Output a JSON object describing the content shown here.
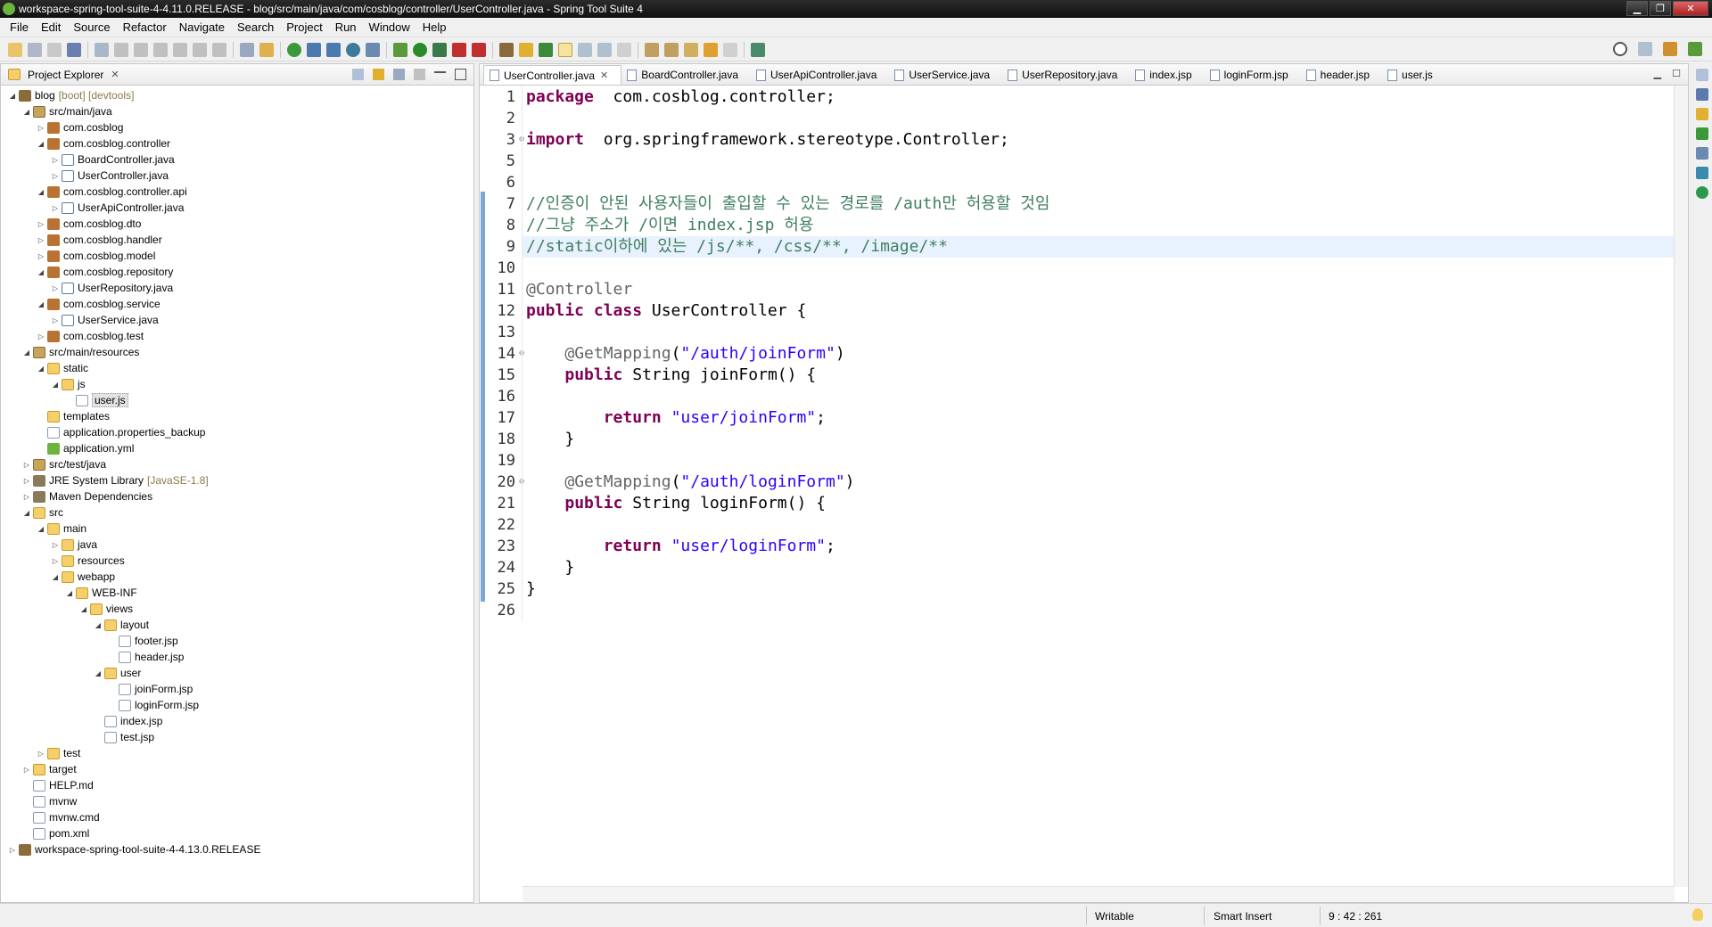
{
  "window": {
    "title": "workspace-spring-tool-suite-4-4.11.0.RELEASE - blog/src/main/java/com/cosblog/controller/UserController.java - Spring Tool Suite 4"
  },
  "menu": [
    "File",
    "Edit",
    "Source",
    "Refactor",
    "Navigate",
    "Search",
    "Project",
    "Run",
    "Window",
    "Help"
  ],
  "project_explorer": {
    "title": "Project Explorer",
    "tree": [
      {
        "label": "blog",
        "deco": "[boot] [devtools]",
        "depth": 0,
        "twisty": "open",
        "icon": "project"
      },
      {
        "label": "src/main/java",
        "depth": 1,
        "twisty": "open",
        "icon": "srcfolder"
      },
      {
        "label": "com.cosblog",
        "depth": 2,
        "twisty": "closed",
        "icon": "package"
      },
      {
        "label": "com.cosblog.controller",
        "depth": 2,
        "twisty": "open",
        "icon": "package"
      },
      {
        "label": "BoardController.java",
        "depth": 3,
        "twisty": "closed",
        "icon": "java"
      },
      {
        "label": "UserController.java",
        "depth": 3,
        "twisty": "closed",
        "icon": "java"
      },
      {
        "label": "com.cosblog.controller.api",
        "depth": 2,
        "twisty": "open",
        "icon": "package"
      },
      {
        "label": "UserApiController.java",
        "depth": 3,
        "twisty": "closed",
        "icon": "java"
      },
      {
        "label": "com.cosblog.dto",
        "depth": 2,
        "twisty": "closed",
        "icon": "package"
      },
      {
        "label": "com.cosblog.handler",
        "depth": 2,
        "twisty": "closed",
        "icon": "package"
      },
      {
        "label": "com.cosblog.model",
        "depth": 2,
        "twisty": "closed",
        "icon": "package"
      },
      {
        "label": "com.cosblog.repository",
        "depth": 2,
        "twisty": "open",
        "icon": "package"
      },
      {
        "label": "UserRepository.java",
        "depth": 3,
        "twisty": "closed",
        "icon": "java"
      },
      {
        "label": "com.cosblog.service",
        "depth": 2,
        "twisty": "open",
        "icon": "package"
      },
      {
        "label": "UserService.java",
        "depth": 3,
        "twisty": "closed",
        "icon": "java"
      },
      {
        "label": "com.cosblog.test",
        "depth": 2,
        "twisty": "closed",
        "icon": "package"
      },
      {
        "label": "src/main/resources",
        "depth": 1,
        "twisty": "open",
        "icon": "srcfolder"
      },
      {
        "label": "static",
        "depth": 2,
        "twisty": "open",
        "icon": "folder"
      },
      {
        "label": "js",
        "depth": 3,
        "twisty": "open",
        "icon": "folder"
      },
      {
        "label": "user.js",
        "depth": 4,
        "twisty": "none",
        "icon": "file",
        "selected": true
      },
      {
        "label": "templates",
        "depth": 2,
        "twisty": "none",
        "icon": "folder"
      },
      {
        "label": "application.properties_backup",
        "depth": 2,
        "twisty": "none",
        "icon": "file"
      },
      {
        "label": "application.yml",
        "depth": 2,
        "twisty": "none",
        "icon": "yml"
      },
      {
        "label": "src/test/java",
        "depth": 1,
        "twisty": "closed",
        "icon": "srcfolder"
      },
      {
        "label": "JRE System Library",
        "deco": "[JavaSE-1.8]",
        "depth": 1,
        "twisty": "closed",
        "icon": "lib"
      },
      {
        "label": "Maven Dependencies",
        "depth": 1,
        "twisty": "closed",
        "icon": "lib"
      },
      {
        "label": "src",
        "depth": 1,
        "twisty": "open",
        "icon": "folder"
      },
      {
        "label": "main",
        "depth": 2,
        "twisty": "open",
        "icon": "folder"
      },
      {
        "label": "java",
        "depth": 3,
        "twisty": "closed",
        "icon": "folder"
      },
      {
        "label": "resources",
        "depth": 3,
        "twisty": "closed",
        "icon": "folder"
      },
      {
        "label": "webapp",
        "depth": 3,
        "twisty": "open",
        "icon": "folder"
      },
      {
        "label": "WEB-INF",
        "depth": 4,
        "twisty": "open",
        "icon": "folder"
      },
      {
        "label": "views",
        "depth": 5,
        "twisty": "open",
        "icon": "folder"
      },
      {
        "label": "layout",
        "depth": 6,
        "twisty": "open",
        "icon": "folder"
      },
      {
        "label": "footer.jsp",
        "depth": 7,
        "twisty": "none",
        "icon": "file"
      },
      {
        "label": "header.jsp",
        "depth": 7,
        "twisty": "none",
        "icon": "file"
      },
      {
        "label": "user",
        "depth": 6,
        "twisty": "open",
        "icon": "folder"
      },
      {
        "label": "joinForm.jsp",
        "depth": 7,
        "twisty": "none",
        "icon": "file"
      },
      {
        "label": "loginForm.jsp",
        "depth": 7,
        "twisty": "none",
        "icon": "file"
      },
      {
        "label": "index.jsp",
        "depth": 6,
        "twisty": "none",
        "icon": "file"
      },
      {
        "label": "test.jsp",
        "depth": 6,
        "twisty": "none",
        "icon": "file"
      },
      {
        "label": "test",
        "depth": 2,
        "twisty": "closed",
        "icon": "folder"
      },
      {
        "label": "target",
        "depth": 1,
        "twisty": "closed",
        "icon": "folder"
      },
      {
        "label": "HELP.md",
        "depth": 1,
        "twisty": "none",
        "icon": "file"
      },
      {
        "label": "mvnw",
        "depth": 1,
        "twisty": "none",
        "icon": "file"
      },
      {
        "label": "mvnw.cmd",
        "depth": 1,
        "twisty": "none",
        "icon": "file"
      },
      {
        "label": "pom.xml",
        "depth": 1,
        "twisty": "none",
        "icon": "file"
      },
      {
        "label": "workspace-spring-tool-suite-4-4.13.0.RELEASE",
        "depth": 0,
        "twisty": "closed",
        "icon": "project"
      }
    ]
  },
  "editor": {
    "tabs": [
      {
        "label": "UserController.java",
        "active": true
      },
      {
        "label": "BoardController.java"
      },
      {
        "label": "UserApiController.java"
      },
      {
        "label": "UserService.java"
      },
      {
        "label": "UserRepository.java"
      },
      {
        "label": "index.jsp"
      },
      {
        "label": "loginForm.jsp"
      },
      {
        "label": "header.jsp"
      },
      {
        "label": "user.js"
      }
    ],
    "lines": [
      {
        "n": "1",
        "tokens": [
          [
            "kw",
            "package"
          ],
          [
            "",
            "  com.cosblog.controller;"
          ]
        ]
      },
      {
        "n": "2",
        "tokens": []
      },
      {
        "n": "3",
        "fold": "+",
        "tokens": [
          [
            "kw",
            "import"
          ],
          [
            "",
            "  org.springframework.stereotype.Controller;"
          ]
        ]
      },
      {
        "n": "5",
        "tokens": []
      },
      {
        "n": "6",
        "tokens": []
      },
      {
        "n": "7",
        "tokens": [
          [
            "cmt",
            "//인증이 안된 사용자들이 출입할 수 있는 경로를 /auth만 허용할 것임"
          ]
        ]
      },
      {
        "n": "8",
        "tokens": [
          [
            "cmt",
            "//그냥 주소가 /이면 index.jsp 허용"
          ]
        ]
      },
      {
        "n": "9",
        "current": true,
        "tokens": [
          [
            "cmt",
            "//static이하에 있는 /js/**, /css/**, /image/**"
          ]
        ]
      },
      {
        "n": "10",
        "tokens": []
      },
      {
        "n": "11",
        "tokens": [
          [
            "ann",
            "@Controller"
          ]
        ]
      },
      {
        "n": "12",
        "tokens": [
          [
            "kw",
            "public class"
          ],
          [
            "",
            " UserController {"
          ]
        ]
      },
      {
        "n": "13",
        "tokens": []
      },
      {
        "n": "14",
        "fold": "-",
        "tokens": [
          [
            "",
            "    "
          ],
          [
            "ann",
            "@GetMapping"
          ],
          [
            "",
            "("
          ],
          [
            "str",
            "\"/auth/joinForm\""
          ],
          [
            "",
            ")"
          ]
        ]
      },
      {
        "n": "15",
        "tokens": [
          [
            "",
            "    "
          ],
          [
            "kw",
            "public"
          ],
          [
            "",
            " String joinForm() {"
          ]
        ]
      },
      {
        "n": "16",
        "tokens": []
      },
      {
        "n": "17",
        "tokens": [
          [
            "",
            "        "
          ],
          [
            "kw",
            "return"
          ],
          [
            "",
            " "
          ],
          [
            "str",
            "\"user/joinForm\""
          ],
          [
            "",
            ";"
          ]
        ]
      },
      {
        "n": "18",
        "tokens": [
          [
            "",
            "    }"
          ]
        ]
      },
      {
        "n": "19",
        "tokens": []
      },
      {
        "n": "20",
        "fold": "-",
        "tokens": [
          [
            "",
            "    "
          ],
          [
            "ann",
            "@GetMapping"
          ],
          [
            "",
            "("
          ],
          [
            "str",
            "\"/auth/loginForm\""
          ],
          [
            "",
            ")"
          ]
        ]
      },
      {
        "n": "21",
        "tokens": [
          [
            "",
            "    "
          ],
          [
            "kw",
            "public"
          ],
          [
            "",
            " String loginForm() {"
          ]
        ]
      },
      {
        "n": "22",
        "tokens": []
      },
      {
        "n": "23",
        "tokens": [
          [
            "",
            "        "
          ],
          [
            "kw",
            "return"
          ],
          [
            "",
            " "
          ],
          [
            "str",
            "\"user/loginForm\""
          ],
          [
            "",
            ";"
          ]
        ]
      },
      {
        "n": "24",
        "tokens": [
          [
            "",
            "    }"
          ]
        ]
      },
      {
        "n": "25",
        "tokens": [
          [
            "",
            "}"
          ]
        ]
      },
      {
        "n": "26",
        "tokens": []
      }
    ]
  },
  "status": {
    "writable": "Writable",
    "insert_mode": "Smart Insert",
    "position": "9 : 42 : 261"
  }
}
